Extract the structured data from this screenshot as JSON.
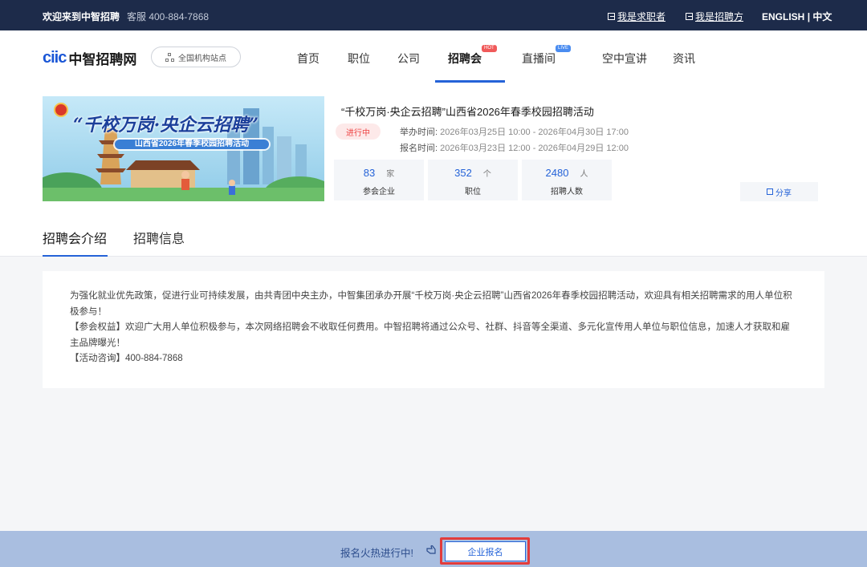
{
  "topbar": {
    "welcome": "欢迎来到中智招聘",
    "service": "客服 400-884-7868",
    "job_seeker": "我是求职者",
    "recruiter": "我是招聘方",
    "lang_en": "ENGLISH",
    "lang_sep": "|",
    "lang_zh": "中文"
  },
  "header": {
    "logo_latin": "CIIC",
    "logo_cn": "中智招聘网",
    "branch_button": "全国机构站点",
    "nav": [
      {
        "label": "首页"
      },
      {
        "label": "职位"
      },
      {
        "label": "公司"
      },
      {
        "label": "招聘会",
        "badge": "HOT",
        "active": true
      },
      {
        "label": "直播间",
        "badge": "LIVE"
      },
      {
        "label": "空中宣讲"
      },
      {
        "label": "资讯"
      }
    ]
  },
  "banner": {
    "headline": "“千校万岗·央企云招聘”",
    "subline": "山西省2026年春季校园招聘活动"
  },
  "event": {
    "title": "“千校万岗·央企云招聘”山西省2026年春季校园招聘活动",
    "status": "进行中",
    "hold_label": "举办时间:",
    "hold_time": "2026年03月25日 10:00 - 2026年04月30日 17:00",
    "signup_label": "报名时间:",
    "signup_time": "2026年03月23日 12:00 - 2026年04月29日 12:00",
    "stats": [
      {
        "value": "83",
        "unit": "家",
        "caption": "参会企业"
      },
      {
        "value": "352",
        "unit": "个",
        "caption": "职位"
      },
      {
        "value": "2480",
        "unit": "人",
        "caption": "招聘人数"
      }
    ],
    "share": "分享"
  },
  "tabs": [
    {
      "label": "招聘会介绍",
      "active": true
    },
    {
      "label": "招聘信息"
    }
  ],
  "intro": {
    "p1": "为强化就业优先政策，促进行业可持续发展，由共青团中央主办，中智集团承办开展“千校万岗·央企云招聘”山西省2026年春季校园招聘活动，欢迎具有相关招聘需求的用人单位积极参与！",
    "p2": "【参会权益】欢迎广大用人单位积极参与，本次网络招聘会不收取任何费用。中智招聘将通过公众号、社群、抖音等全渠道、多元化宣传用人单位与职位信息，加速人才获取和雇主品牌曝光！",
    "p3": "【活动咨询】400-884-7868"
  },
  "bottombar": {
    "hint": "报名火热进行中!",
    "register": "企业报名"
  },
  "colors": {
    "topbar": "#1d2b4a",
    "accent": "#2563d8",
    "hot": "#f05a5a",
    "bottombar": "#a9bee0",
    "highlight": "#e23c3c"
  }
}
